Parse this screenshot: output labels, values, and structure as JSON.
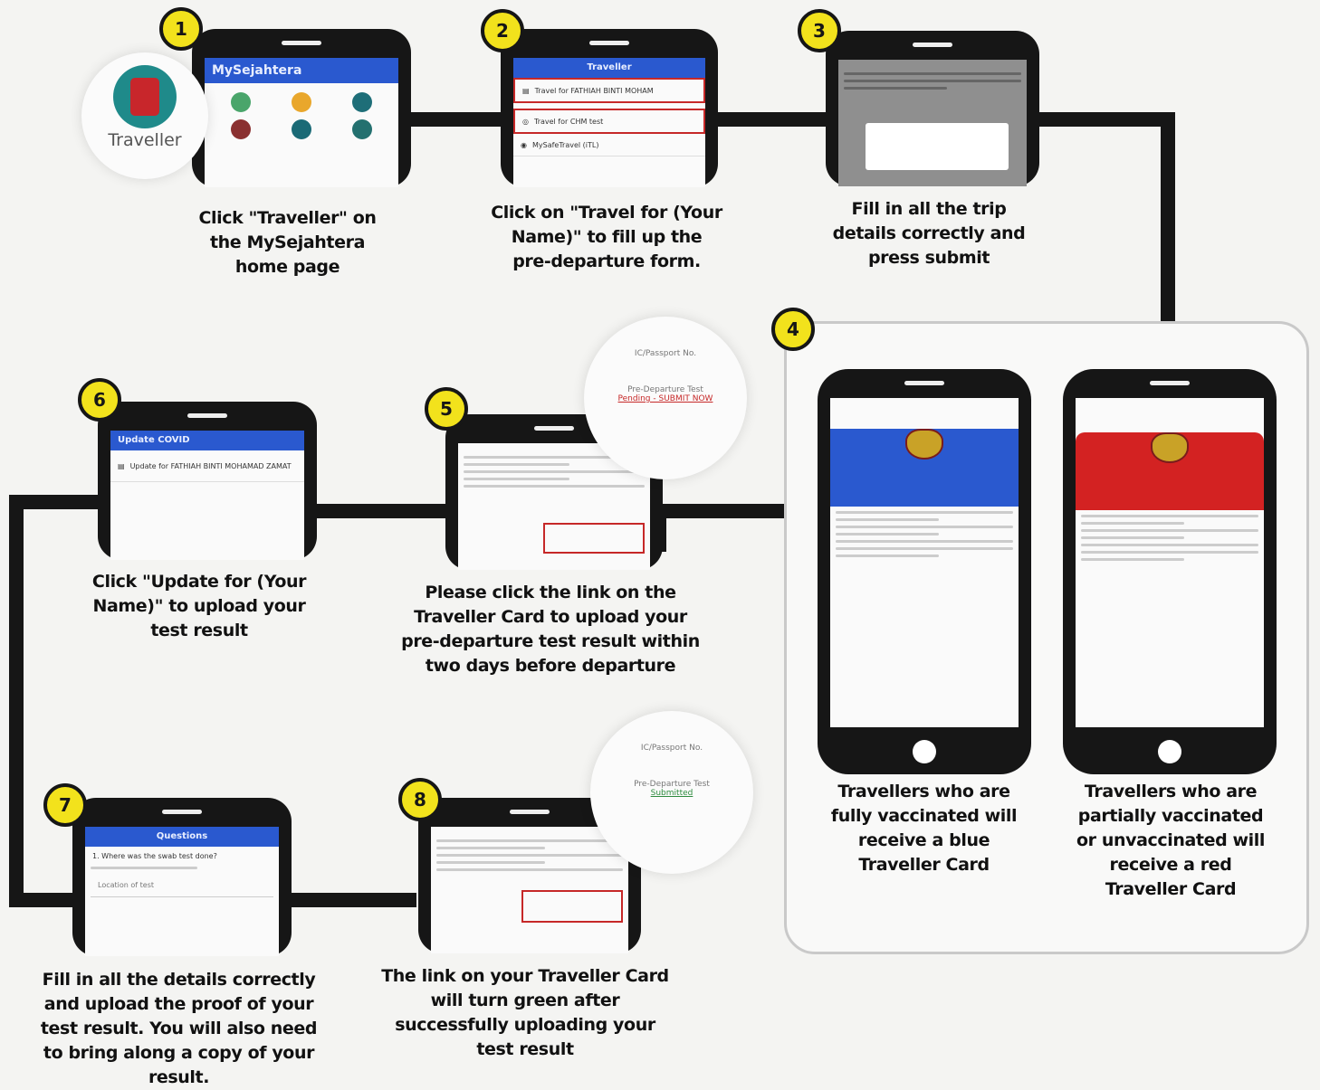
{
  "steps": [
    {
      "num": "1",
      "caption": [
        "Click \"Traveller\" on",
        "the MySejahtera",
        "home page"
      ]
    },
    {
      "num": "2",
      "caption": [
        "Click on \"Travel for (Your",
        "Name)\" to fill up the",
        "pre-departure form."
      ]
    },
    {
      "num": "3",
      "caption": [
        "Fill in all the trip",
        "details correctly and",
        "press submit"
      ]
    },
    {
      "num": "4",
      "caption": []
    },
    {
      "num": "5",
      "caption": [
        "Please click the link on the",
        "Traveller Card to upload your",
        "pre-departure test result within",
        "two days before departure"
      ]
    },
    {
      "num": "6",
      "caption": [
        "Click \"Update for (Your",
        "Name)\" to upload your",
        "test result"
      ]
    },
    {
      "num": "7",
      "caption": [
        "Fill in all the details correctly",
        "and upload the proof of your",
        "test result. You will also need",
        "to bring along a copy of your",
        "result."
      ]
    },
    {
      "num": "8",
      "caption": [
        "The link on your Traveller Card",
        "will turn green after",
        "successfully uploading your",
        "test result"
      ]
    }
  ],
  "cards": {
    "blue_caption": [
      "Travellers who are",
      "fully vaccinated will",
      "receive a blue",
      "Traveller Card"
    ],
    "red_caption": [
      "Travellers who are",
      "partially vaccinated",
      "or  unvaccinated will",
      "receive a red",
      "Traveller Card"
    ]
  },
  "icons": {
    "traveller_label": "Traveller"
  },
  "screens": {
    "home_title": "MySejahtera",
    "traveller_title": "Traveller",
    "travel_for_item": "Travel for FATHIAH BINTI MOHAM",
    "travel_chm_item": "Travel for CHM test",
    "mysafe_item": "MySafeTravel (iTL)",
    "update_title": "Update COVID",
    "update_item": "Update for FATHIAH BINTI MOHAMAD ZAMAT",
    "question_title": "Questions",
    "question_item": "1. Where was the swab test done?",
    "location_placeholder": "Location of test"
  },
  "zoom_pending": {
    "label": "IC/Passport No.",
    "sublabel": "Pre-Departure Test",
    "status": "Pending - SUBMIT NOW"
  },
  "zoom_done": {
    "label": "IC/Passport No.",
    "sublabel": "Pre-Departure Test",
    "status": "Submitted"
  },
  "colors": {
    "badge": "#f2e21c",
    "connector": "#161616",
    "blue_card": "#2a59cf",
    "red_card": "#d32222",
    "highlight": "#c62828"
  }
}
